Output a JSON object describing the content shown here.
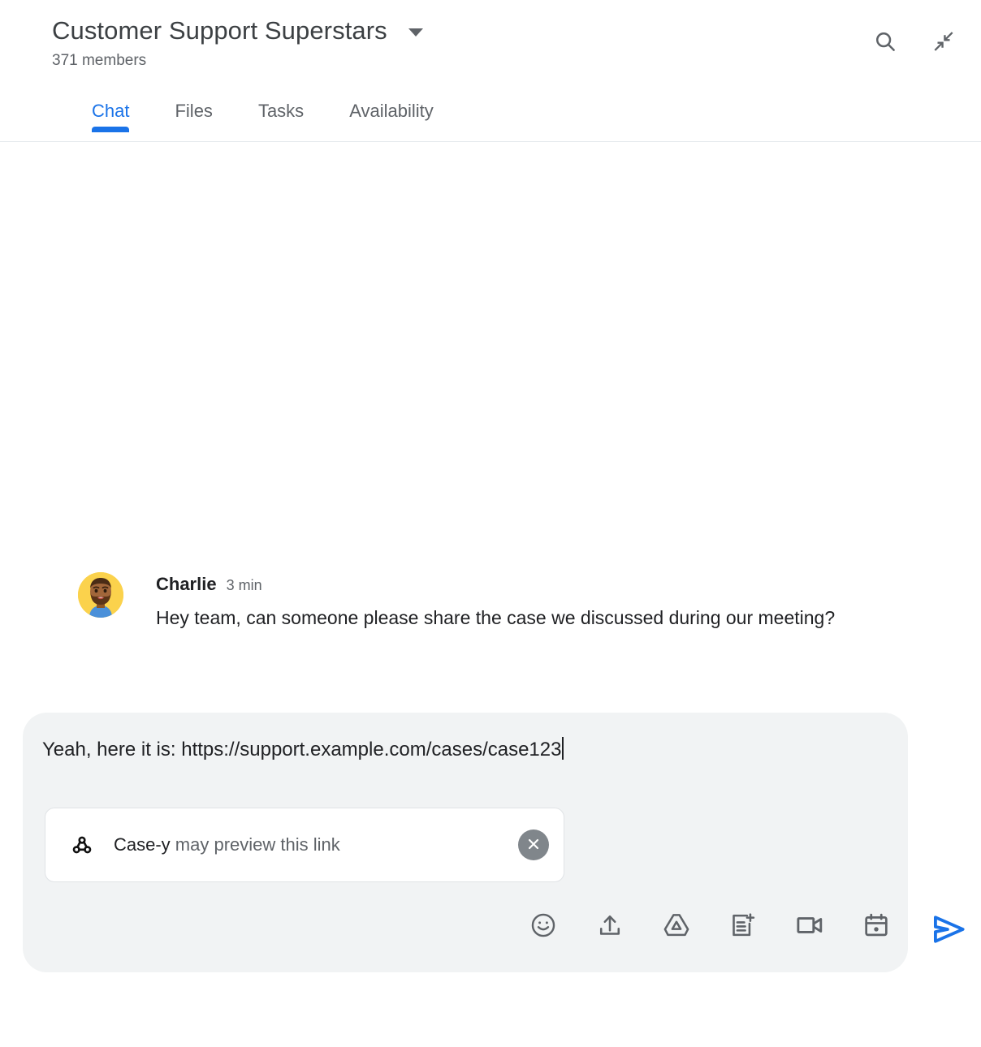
{
  "header": {
    "room_title": "Customer Support Superstars",
    "members": "371 members",
    "caret_icon": "chevron-down-icon",
    "search_icon": "search-icon",
    "collapse_icon": "collapse-arrows-icon"
  },
  "tabs": [
    {
      "label": "Chat",
      "active": true
    },
    {
      "label": "Files",
      "active": false
    },
    {
      "label": "Tasks",
      "active": false
    },
    {
      "label": "Availability",
      "active": false
    }
  ],
  "messages": [
    {
      "author": "Charlie",
      "time": "3 min",
      "text": "Hey team, can someone please share the case we discussed during our meeting?",
      "avatar": "bearded-man-avatar"
    }
  ],
  "compose": {
    "text": "Yeah, here it is: https://support.example.com/cases/case123",
    "link_chip": {
      "app_name": "Case-y",
      "message": " may preview this link",
      "app_icon": "webhook-icon",
      "close_icon": "close-icon"
    },
    "actions": [
      {
        "name": "emoji-icon",
        "label": "Insert emoji"
      },
      {
        "name": "upload-icon",
        "label": "Upload file"
      },
      {
        "name": "google-drive-icon",
        "label": "Add from Drive"
      },
      {
        "name": "add-document-icon",
        "label": "Create a document"
      },
      {
        "name": "video-camera-icon",
        "label": "Add video meeting"
      },
      {
        "name": "calendar-icon",
        "label": "Create event"
      }
    ],
    "send_icon": "send-icon"
  },
  "colors": {
    "accent": "#1a73e8",
    "text_primary": "#202124",
    "text_secondary": "#5f6368",
    "compose_bg": "#f1f3f4",
    "avatar_bg": "#fbd24c"
  }
}
